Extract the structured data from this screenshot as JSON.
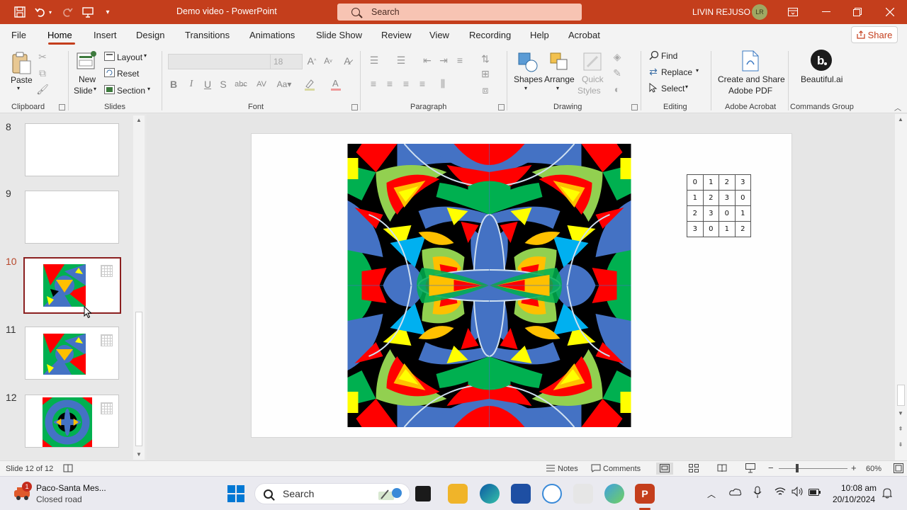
{
  "titlebar": {
    "doc_title": "Demo video  -  PowerPoint",
    "search_placeholder": "Search",
    "user_name": "LIVIN REJUSO",
    "user_initials": "LR"
  },
  "menu": {
    "tabs": [
      "File",
      "Home",
      "Insert",
      "Design",
      "Transitions",
      "Animations",
      "Slide Show",
      "Review",
      "View",
      "Recording",
      "Help",
      "Acrobat"
    ],
    "active": "Home",
    "share_label": "Share"
  },
  "ribbon": {
    "clipboard": {
      "paste": "Paste",
      "label": "Clipboard"
    },
    "slides": {
      "new_slide_1": "New",
      "new_slide_2": "Slide",
      "layout": "Layout",
      "reset": "Reset",
      "section": "Section",
      "label": "Slides"
    },
    "font": {
      "size": "18",
      "label": "Font"
    },
    "paragraph": {
      "label": "Paragraph"
    },
    "drawing": {
      "shapes": "Shapes",
      "arrange": "Arrange",
      "quick_1": "Quick",
      "quick_2": "Styles",
      "label": "Drawing"
    },
    "editing": {
      "find": "Find",
      "replace": "Replace",
      "select": "Select",
      "label": "Editing"
    },
    "acrobat": {
      "create_1": "Create and Share",
      "create_2": "Adobe PDF",
      "label": "Adobe Acrobat"
    },
    "commands": {
      "beautiful": "Beautiful.ai",
      "label": "Commands Group"
    }
  },
  "thumbnails": {
    "items": [
      {
        "num": "8"
      },
      {
        "num": "9"
      },
      {
        "num": "10"
      },
      {
        "num": "11"
      },
      {
        "num": "12"
      }
    ],
    "selected": "10"
  },
  "slide": {
    "table": [
      [
        "0",
        "1",
        "2",
        "3"
      ],
      [
        "1",
        "2",
        "3",
        "0"
      ],
      [
        "2",
        "3",
        "0",
        "1"
      ],
      [
        "3",
        "0",
        "1",
        "2"
      ]
    ]
  },
  "status": {
    "slide_info": "Slide 12 of 12",
    "notes": "Notes",
    "comments": "Comments",
    "zoom": "60%"
  },
  "taskbar": {
    "weather_title": "Paco-Santa Mes...",
    "weather_sub": "Closed road",
    "weather_badge": "1",
    "search": "Search",
    "time": "10:08 am",
    "date": "20/10/2024"
  },
  "colors": {
    "accent": "#c43e1c",
    "mandala_blue": "#4472c4",
    "mandala_green": "#00b050",
    "mandala_red": "#ff0000",
    "mandala_yellow": "#ffff00"
  }
}
